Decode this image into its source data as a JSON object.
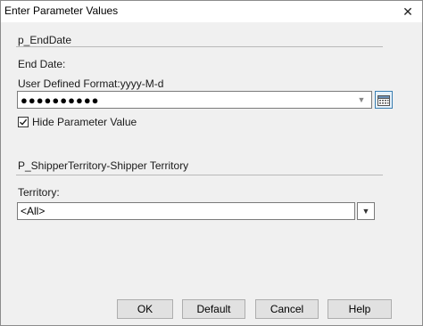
{
  "window": {
    "title": "Enter Parameter Values"
  },
  "params": [
    {
      "section_title": "p_EndDate",
      "label": "End Date:",
      "format_label": "User Defined Format:yyyy-M-d",
      "value": "●●●●●●●●●●",
      "hide_checkbox": {
        "label": "Hide Parameter Value",
        "checked": true
      }
    },
    {
      "section_title": "P_ShipperTerritory-Shipper Territory",
      "label": "Territory:",
      "value": "<All>"
    }
  ],
  "buttons": {
    "ok": "OK",
    "default": "Default",
    "cancel": "Cancel",
    "help": "Help"
  },
  "icons": {
    "close": "close-icon",
    "dropdown": "chevron-down-icon",
    "calendar": "calendar-icon",
    "check": "check-icon"
  },
  "colors": {
    "accent": "#3c7fb1",
    "dialog_bg": "#f0f0f0",
    "field_border": "#7a7a7a"
  }
}
